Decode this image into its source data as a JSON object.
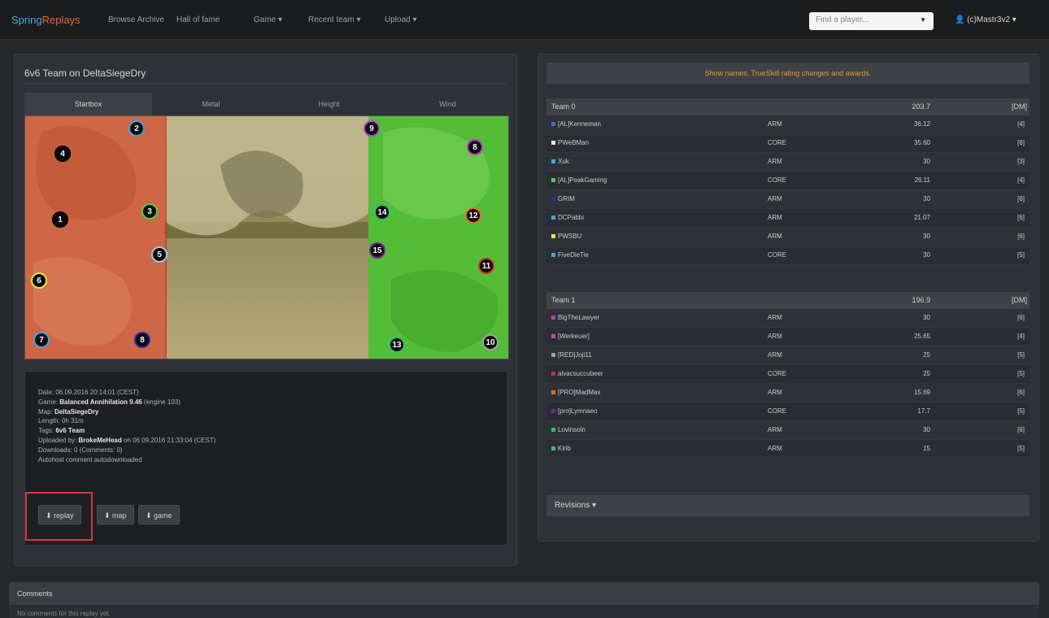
{
  "navbar": {
    "brand_part1": "Spring",
    "brand_part2": "Replays",
    "items": [
      "Browse Archive",
      "Hall of fame",
      "Game ▾",
      "Recent team ▾",
      "Upload ▾"
    ],
    "search_placeholder": "Find a player...",
    "user": "(c)Mastr3v2 ▾"
  },
  "match": {
    "title": "6v6 Team on DeltaSiegeDry",
    "tabs": [
      "Startbox",
      "Metal",
      "Height",
      "Wind"
    ],
    "active_tab": "Startbox",
    "info": {
      "date_label": "Date:",
      "date": "06.09.2016 20:14:01 (CEST)",
      "game_label": "Game:",
      "game": "Balanced Annihilation 9.46",
      "game_extra": "(engine 103)",
      "map_label": "Map:",
      "map": "DeltaSiegeDry",
      "length_label": "Length:",
      "length": "0h 31m",
      "tags_label": "Tags:",
      "tags": "6v6 Team",
      "uploaded_label": "Uploaded by:",
      "uploaded_by": "BrokeMeHead",
      "uploaded_at": "on 06.09.2016 21:33:04 (CEST)",
      "downloads": "Downloads: 0 (Comments: 0)",
      "autohost": "Autohost comment autodownloaded"
    },
    "buttons": {
      "replay": "⬇ replay",
      "map": "⬇ map",
      "game": "⬇ game"
    }
  },
  "scores": {
    "alert": "Show names, TrueSkill rating changes and awards.",
    "teams": [
      {
        "name": "Team 0",
        "ts": "203.7",
        "dm": "[DM]",
        "players": [
          {
            "name": "[AL]Kenneman",
            "faction": "ARM",
            "ts": "36.12",
            "dm": "[4]",
            "color": "#3b6fe0"
          },
          {
            "name": "PWeBMan",
            "faction": "CORE",
            "ts": "35.60",
            "dm": "[6]",
            "color": "#e3e3e3"
          },
          {
            "name": "Xuk",
            "faction": "ARM",
            "ts": "30",
            "dm": "[3]",
            "color": "#3fa8e0"
          },
          {
            "name": "[AL]PeakGaming",
            "faction": "CORE",
            "ts": "26.11",
            "dm": "[4]",
            "color": "#4ad04a"
          },
          {
            "name": "GRIM",
            "faction": "ARM",
            "ts": "30",
            "dm": "[6]",
            "color": "#2a2ab0"
          },
          {
            "name": "DCPabbi",
            "faction": "ARM",
            "ts": "21.07",
            "dm": "[6]",
            "color": "#3fa8e0"
          },
          {
            "name": "PWSBU",
            "faction": "ARM",
            "ts": "30",
            "dm": "[6]",
            "color": "#e8e04a"
          },
          {
            "name": "FiveDieTie",
            "faction": "CORE",
            "ts": "30",
            "dm": "[5]",
            "color": "#3fa8e0"
          }
        ]
      },
      {
        "name": "Team 1",
        "ts": "196.9",
        "dm": "[DM]",
        "players": [
          {
            "name": "BigTheLawyer",
            "faction": "ARM",
            "ts": "30",
            "dm": "[6]",
            "color": "#b040c0"
          },
          {
            "name": "[Werkeuer]",
            "faction": "ARM",
            "ts": "25.65",
            "dm": "[4]",
            "color": "#c040d0"
          },
          {
            "name": "[RED]Joji11",
            "faction": "ARM",
            "ts": "25",
            "dm": "[5]",
            "color": "#a0a0a0"
          },
          {
            "name": "alvacsuccubeer",
            "faction": "CORE",
            "ts": "25",
            "dm": "[5]",
            "color": "#d03030"
          },
          {
            "name": "[PRO]MadMax",
            "faction": "ARM",
            "ts": "15.69",
            "dm": "[6]",
            "color": "#e07020"
          },
          {
            "name": "[pro]Lymnaeo",
            "faction": "CORE",
            "ts": "17.7",
            "dm": "[5]",
            "color": "#8020a0"
          },
          {
            "name": "Lovinsoln",
            "faction": "ARM",
            "ts": "30",
            "dm": "[6]",
            "color": "#30c070"
          },
          {
            "name": "Kirib",
            "faction": "ARM",
            "ts": "15",
            "dm": "[5]",
            "color": "#30c070"
          }
        ]
      }
    ],
    "revisions": "Revisions ▾"
  },
  "comments": {
    "title": "Comments",
    "body": "No comments for this replay yet."
  },
  "markers": [
    {
      "n": "1",
      "ring": "#0a0a0a"
    },
    {
      "n": "2",
      "ring": "#3fa8e0"
    },
    {
      "n": "3",
      "ring": "#4ad04a"
    },
    {
      "n": "4",
      "ring": "#0a0a0a"
    },
    {
      "n": "5",
      "ring": "#9ec9e0"
    },
    {
      "n": "6",
      "ring": "#e8e04a"
    },
    {
      "n": "7",
      "ring": "#3fa8e0"
    },
    {
      "n": "8",
      "ring": "#2a2ab0"
    },
    {
      "n": "9",
      "ring": "#c040d0"
    },
    {
      "n": "8",
      "ring": "#c040d0"
    },
    {
      "n": "14",
      "ring": "#30c070"
    },
    {
      "n": "12",
      "ring": "#e07020"
    },
    {
      "n": "11",
      "ring": "#d03030"
    },
    {
      "n": "15",
      "ring": "#8020a0"
    },
    {
      "n": "13",
      "ring": "#30c070"
    },
    {
      "n": "10",
      "ring": "#a0a0a0"
    }
  ]
}
